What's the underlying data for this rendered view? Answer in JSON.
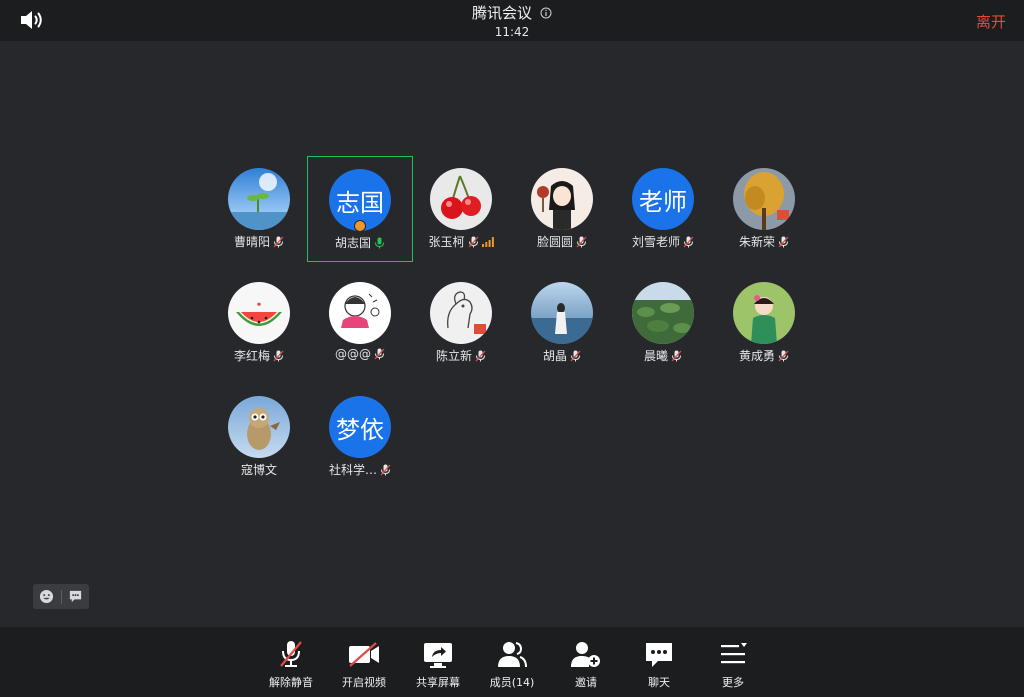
{
  "header": {
    "title": "腾讯会议",
    "time": "11:42",
    "leave_label": "离开",
    "icons": {
      "speaker": "speaker-icon",
      "info": "info-icon"
    }
  },
  "participants": [
    {
      "name": "曹晴阳",
      "avatar": "image",
      "image": "sky-sprout",
      "mic": "muted",
      "active": false
    },
    {
      "name": "胡志国",
      "avatar": "text",
      "avatar_text": "志国",
      "mic": "on",
      "host": true,
      "active": true
    },
    {
      "name": "张玉柯",
      "avatar": "image",
      "image": "cherries",
      "mic": "muted",
      "signal": true,
      "active": false
    },
    {
      "name": "脸圆圆",
      "avatar": "image",
      "image": "cartoon-girl",
      "mic": "muted",
      "active": false
    },
    {
      "name": "刘雪老师",
      "avatar": "text",
      "avatar_text": "老师",
      "mic": "muted",
      "active": false
    },
    {
      "name": "朱新荣",
      "avatar": "image",
      "image": "autumn-tree",
      "mic": "muted",
      "active": false
    },
    {
      "name": "李红梅",
      "avatar": "image",
      "image": "watermelon",
      "mic": "muted",
      "active": false
    },
    {
      "name": "@@@",
      "avatar": "image",
      "image": "sketch-girl",
      "mic": "muted",
      "active": false
    },
    {
      "name": "陈立新",
      "avatar": "image",
      "image": "pony-sketch",
      "mic": "muted",
      "active": false
    },
    {
      "name": "胡晶",
      "avatar": "image",
      "image": "seaside-girl",
      "mic": "muted",
      "active": false
    },
    {
      "name": "晨曦",
      "avatar": "image",
      "image": "lotus-pond",
      "mic": "muted",
      "active": false
    },
    {
      "name": "黄成勇",
      "avatar": "image",
      "image": "child-portrait",
      "mic": "muted",
      "active": false
    },
    {
      "name": "寇博文",
      "avatar": "image",
      "image": "owl-figure",
      "mic": "none",
      "active": false
    },
    {
      "name": "社科学…",
      "avatar": "text",
      "avatar_text": "梦依",
      "mic": "muted",
      "active": false
    }
  ],
  "mini_tools": {
    "emoji": "emoji-icon",
    "chat": "chat-bubble-icon"
  },
  "toolbar": [
    {
      "key": "unmute",
      "label": "解除静音",
      "icon": "mic-muted-icon"
    },
    {
      "key": "video",
      "label": "开启视频",
      "icon": "camera-off-icon"
    },
    {
      "key": "share",
      "label": "共享屏幕",
      "icon": "share-screen-icon"
    },
    {
      "key": "members",
      "label": "成员(14)",
      "icon": "members-icon"
    },
    {
      "key": "invite",
      "label": "邀请",
      "icon": "add-user-icon"
    },
    {
      "key": "chat",
      "label": "聊天",
      "icon": "chat-icon"
    },
    {
      "key": "more",
      "label": "更多",
      "icon": "more-menu-icon"
    }
  ],
  "colors": {
    "background": "#26282b",
    "bar": "#1c1d1f",
    "avatar_blue": "#1a73e8",
    "active_border": "#1ec15f",
    "leave_red": "#e3493f",
    "mic_on_green": "#2bc156",
    "mute_red": "#e04b4b",
    "host_orange": "#f0962c"
  }
}
